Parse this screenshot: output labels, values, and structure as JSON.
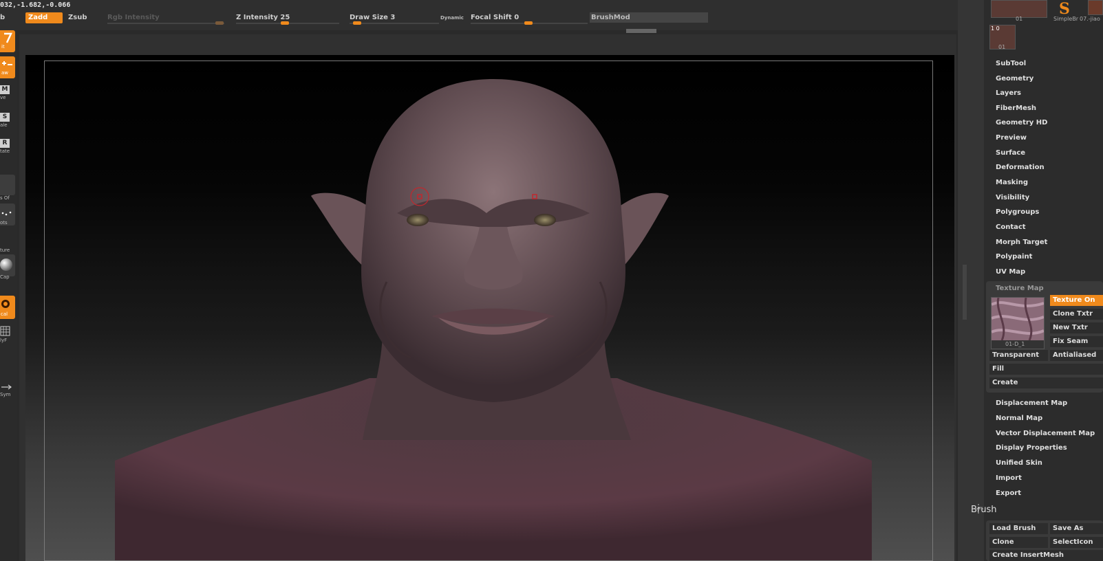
{
  "topbar": {
    "coords": "032,-1.682,-0.066",
    "left_cut": "b",
    "zadd": "Zadd",
    "zsub": "Zsub",
    "rgb_intensity": "Rgb Intensity",
    "z_intensity": "Z Intensity 25",
    "draw_size": "Draw Size 3",
    "dynamic": "Dynamic",
    "focal_shift": "Focal Shift 0",
    "brushmod": "BrushMod"
  },
  "left_tray": {
    "edit": "it",
    "draw": "aw",
    "move_key": "M",
    "move": "ve",
    "scale_key": "S",
    "scale": "ale",
    "rotate_key": "R",
    "rotate": "tate",
    "mat_label": "s Of",
    "dots_label": "ots",
    "texture_label": "ture",
    "cap_label": "Cap",
    "local_label": "cal",
    "polyf_label": "lyF",
    "sym_label": "Sym"
  },
  "thumbs": {
    "label1": "01",
    "label2": "SimpleBr",
    "label3": "07.-jiao",
    "count": "1 0",
    "label4": "01"
  },
  "menu": [
    "SubTool",
    "Geometry",
    "Layers",
    "FiberMesh",
    "Geometry HD",
    "Preview",
    "Surface",
    "Deformation",
    "Masking",
    "Visibility",
    "Polygroups",
    "Contact",
    "Morph Target",
    "Polypaint",
    "UV Map"
  ],
  "texture_map": {
    "header": "Texture Map",
    "texture_on": "Texture On",
    "clone_txtr": "Clone Txtr",
    "new_txtr": "New Txtr",
    "fix_seam": "Fix Seam",
    "thumb_label": "01-D_1",
    "transparent": "Transparent",
    "antialiased": "Antialiased",
    "fill": "Fill",
    "create": "Create"
  },
  "menu2": [
    "Displacement Map",
    "Normal Map",
    "Vector Displacement Map",
    "Display Properties",
    "Unified Skin",
    "Import",
    "Export"
  ],
  "brush": {
    "title": "Brush",
    "load": "Load Brush",
    "save_as": "Save As",
    "clone": "Clone",
    "select_icon": "SelectIcon",
    "create_insert": "Create InsertMesh"
  },
  "colors": {
    "accent": "#f08a1c",
    "panel": "#2c2c2c",
    "skin": "#6e5458"
  }
}
